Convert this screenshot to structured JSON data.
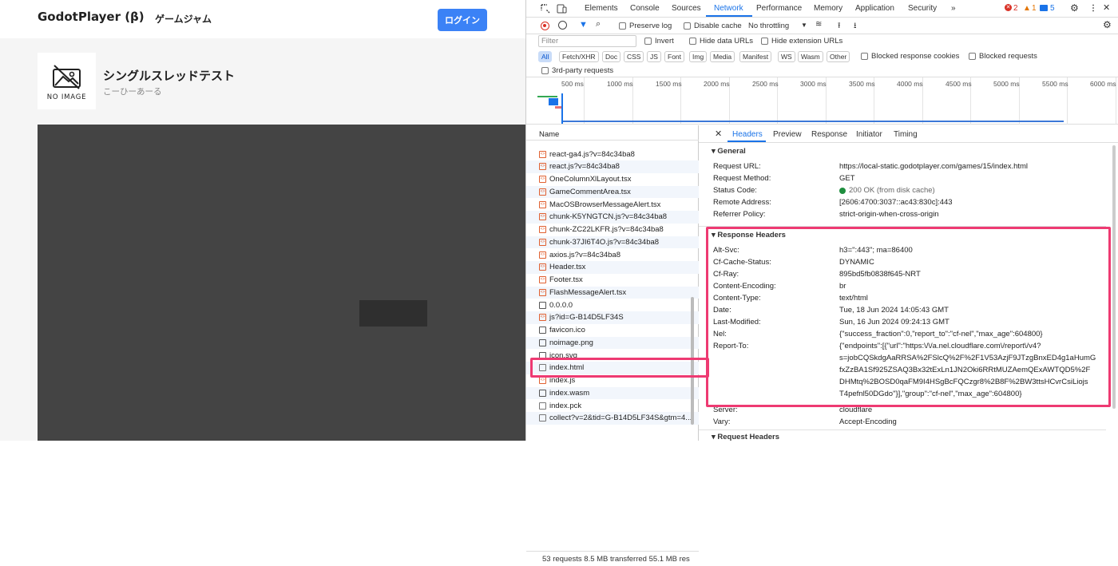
{
  "site": {
    "brand": "GodotPlayer (β)",
    "nav_game_jam": "ゲームジャム",
    "login": "ログイン"
  },
  "game": {
    "title": "シングルスレッドテスト",
    "author": "こーひーあーる",
    "thumb_text": "NO IMAGE"
  },
  "devtools": {
    "tabs": [
      "Elements",
      "Console",
      "Sources",
      "Network",
      "Performance",
      "Memory",
      "Application",
      "Security",
      "»"
    ],
    "active_tab": "Network",
    "badges": {
      "errors": "2",
      "warnings": "1",
      "info": "5"
    },
    "toolbar": {
      "preserve_log": "Preserve log",
      "disable_cache": "Disable cache",
      "throttling": "No throttling"
    },
    "filter": {
      "placeholder": "Filter",
      "invert": "Invert",
      "hide_data": "Hide data URLs",
      "hide_ext": "Hide extension URLs",
      "third_party": "3rd-party requests",
      "blocked_cookies": "Blocked response cookies",
      "blocked_requests": "Blocked requests"
    },
    "type_chips": [
      "All",
      "Fetch/XHR",
      "Doc",
      "CSS",
      "JS",
      "Font",
      "Img",
      "Media",
      "Manifest",
      "WS",
      "Wasm",
      "Other"
    ],
    "timeline_ticks": [
      "500 ms",
      "1000 ms",
      "1500 ms",
      "2000 ms",
      "2500 ms",
      "3000 ms",
      "3500 ms",
      "4000 ms",
      "4500 ms",
      "5000 ms",
      "5500 ms",
      "6000 ms"
    ],
    "name_header": "Name",
    "requests": [
      {
        "name": "react-ga4.js?v=84c34ba8",
        "icon": "script"
      },
      {
        "name": "react.js?v=84c34ba8",
        "icon": "script"
      },
      {
        "name": "OneColumnXlLayout.tsx",
        "icon": "script"
      },
      {
        "name": "GameCommentArea.tsx",
        "icon": "script"
      },
      {
        "name": "MacOSBrowserMessageAlert.tsx",
        "icon": "script"
      },
      {
        "name": "chunk-K5YNGTCN.js?v=84c34ba8",
        "icon": "script"
      },
      {
        "name": "chunk-ZC22LKFR.js?v=84c34ba8",
        "icon": "script"
      },
      {
        "name": "chunk-37JI6T4O.js?v=84c34ba8",
        "icon": "script"
      },
      {
        "name": "axios.js?v=84c34ba8",
        "icon": "script"
      },
      {
        "name": "Header.tsx",
        "icon": "script"
      },
      {
        "name": "Footer.tsx",
        "icon": "script"
      },
      {
        "name": "FlashMessageAlert.tsx",
        "icon": "script"
      },
      {
        "name": "0.0.0.0",
        "icon": "other"
      },
      {
        "name": "js?id=G-B14D5LF34S",
        "icon": "script"
      },
      {
        "name": "favicon.ico",
        "icon": "image"
      },
      {
        "name": "noimage.png",
        "icon": "image"
      },
      {
        "name": "icon.svg",
        "icon": "image"
      },
      {
        "name": "index.html",
        "icon": "doc"
      },
      {
        "name": "index.js",
        "icon": "script"
      },
      {
        "name": "index.wasm",
        "icon": "wasm"
      },
      {
        "name": "index.pck",
        "icon": "file"
      },
      {
        "name": "collect?v=2&tid=G-B14D5LF34S&gtm=4...",
        "icon": "fetch"
      }
    ],
    "status_bar": "53 requests    8.5 MB transferred    55.1 MB res",
    "detail_tabs": [
      "Headers",
      "Preview",
      "Response",
      "Initiator",
      "Timing"
    ],
    "general_title": "▾ General",
    "general": [
      {
        "k": "Request URL:",
        "v": "https://local-static.godotplayer.com/games/15/index.html"
      },
      {
        "k": "Request Method:",
        "v": "GET"
      },
      {
        "k": "Status Code:",
        "v": "200 OK (from disk cache)"
      },
      {
        "k": "Remote Address:",
        "v": "[2606:4700:3037::ac43:830c]:443"
      },
      {
        "k": "Referrer Policy:",
        "v": "strict-origin-when-cross-origin"
      }
    ],
    "response_title": "▾ Response Headers",
    "response": [
      {
        "k": "Alt-Svc:",
        "v": "h3=\":443\"; ma=86400"
      },
      {
        "k": "Cf-Cache-Status:",
        "v": "DYNAMIC"
      },
      {
        "k": "Cf-Ray:",
        "v": "895bd5fb0838f645-NRT"
      },
      {
        "k": "Content-Encoding:",
        "v": "br"
      },
      {
        "k": "Content-Type:",
        "v": "text/html"
      },
      {
        "k": "Date:",
        "v": "Tue, 18 Jun 2024 14:05:43 GMT"
      },
      {
        "k": "Last-Modified:",
        "v": "Sun, 16 Jun 2024 09:24:13 GMT"
      },
      {
        "k": "Nel:",
        "v": "{\"success_fraction\":0,\"report_to\":\"cf-nel\",\"max_age\":604800}"
      },
      {
        "k": "Report-To:",
        "v": "{\"endpoints\":[{\"url\":\"https:\\/\\/a.nel.cloudflare.com\\/report\\/v4?"
      }
    ],
    "report_to_cont": [
      "s=jobCQSkdgAaRRSA%2FSlcQ%2F%2F1V53AzjF9JTzgBnxED4g1aHumG",
      "fxZzBA1Sf925ZSAQ3Bx32tExLn1JN2Oki6RRtMUZAemQExAWTQD5%2F",
      "DHMtq%2BOSD0qaFM9I4HSgBcFQCzgr8%2B8F%2BW3ttsHCvrCsiLiojs",
      "T4pefnl50DGdo\"}],\"group\":\"cf-nel\",\"max_age\":604800}"
    ],
    "after": [
      {
        "k": "Server:",
        "v": "cloudflare"
      },
      {
        "k": "Vary:",
        "v": "Accept-Encoding"
      }
    ],
    "request_title": "▾ Request Headers"
  },
  "colors": {
    "accent": "#1a73e8",
    "highlight": "#ee3a72",
    "login": "#3b82f6"
  }
}
